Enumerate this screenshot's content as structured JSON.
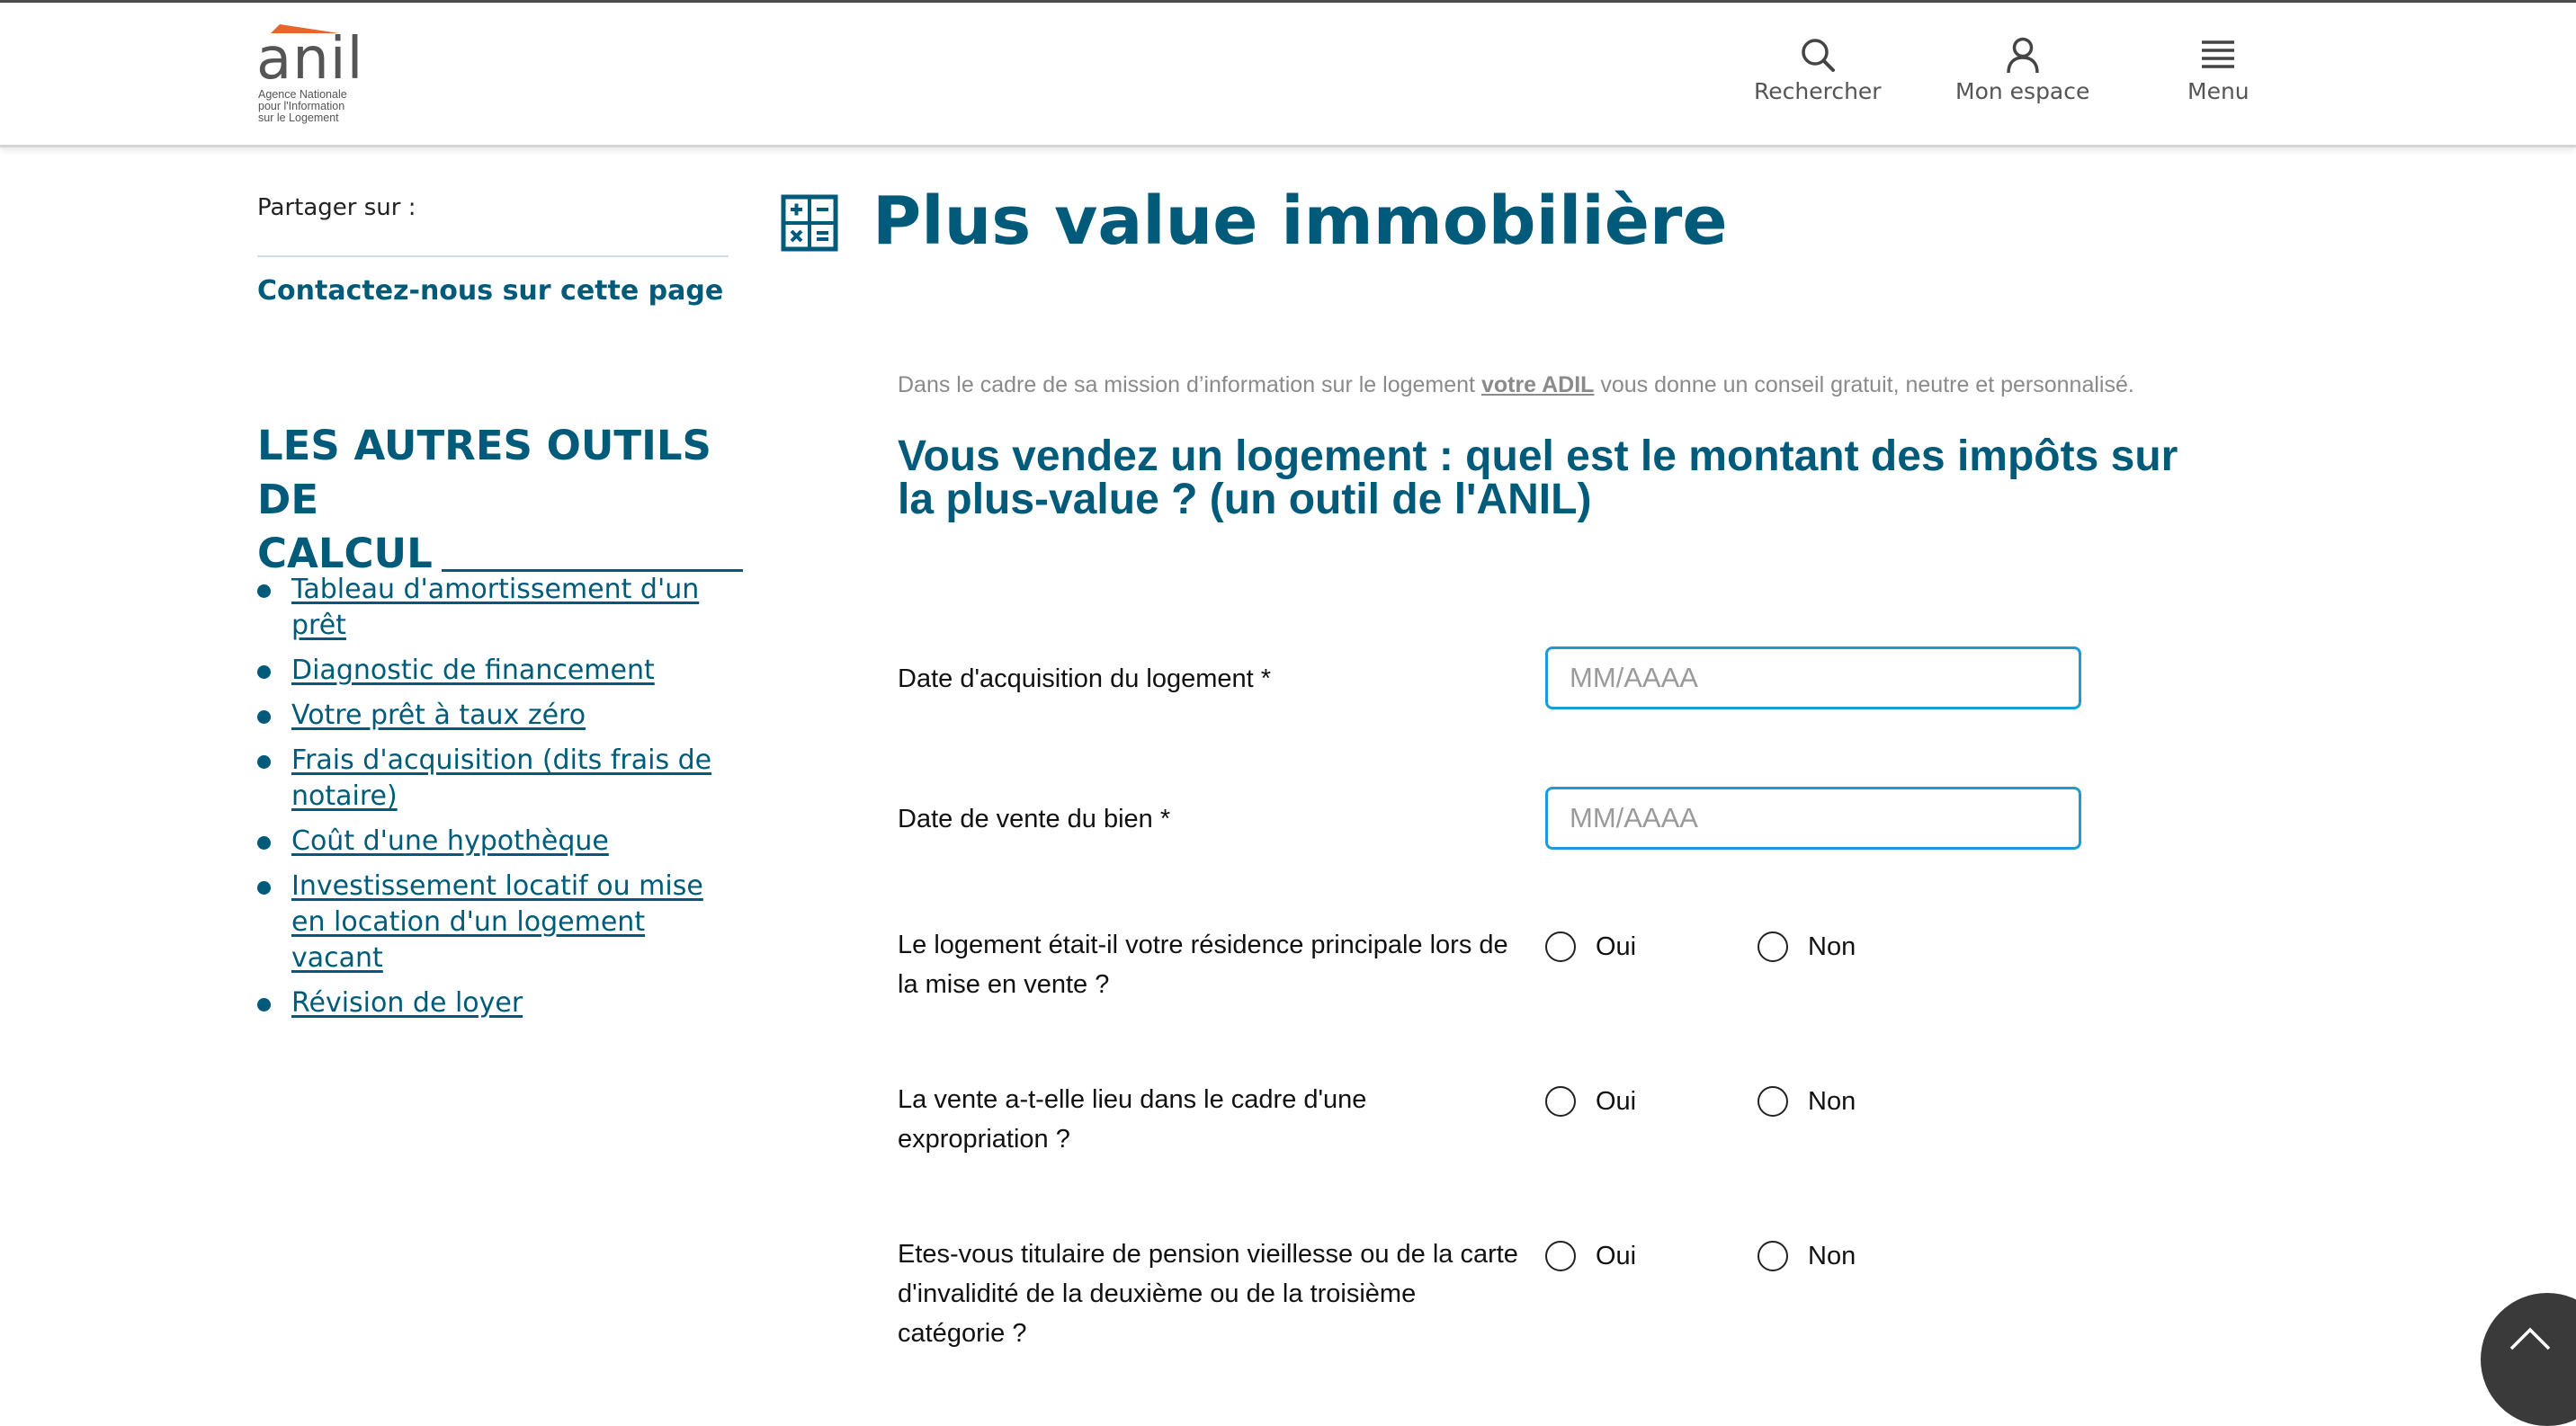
{
  "header": {
    "logo": {
      "word": "anil",
      "tagline": [
        "Agence Nationale",
        "pour l'Information",
        "sur le Logement"
      ]
    },
    "nav": [
      {
        "label": "Rechercher",
        "icon": "search-icon"
      },
      {
        "label": "Mon espace",
        "icon": "user-icon"
      },
      {
        "label": "Menu",
        "icon": "menu-icon"
      }
    ]
  },
  "sidebar": {
    "share_label": "Partager sur :",
    "contact_link": "Contactez-nous sur cette page",
    "title_line1": "LES AUTRES OUTILS DE",
    "title_line2": "CALCUL",
    "tools": [
      "Tableau d'amortissement d'un prêt",
      "Diagnostic de financement",
      "Votre prêt à taux zéro",
      "Frais d'acquisition (dits frais de notaire)",
      "Coût d'une hypothèque",
      "Investissement locatif ou mise en location d'un logement vacant",
      "Révision de loyer"
    ]
  },
  "main": {
    "page_title": "Plus value immobilière",
    "intro_before": "Dans le cadre de sa mission d’information sur le logement ",
    "intro_link": "votre ADIL",
    "intro_after": " vous donne un conseil gratuit, neutre et personnalisé.",
    "question_title": "Vous vendez un logement : quel est le montant des impôts sur la plus-value ? (un outil de l'ANIL)",
    "fields": [
      {
        "label": "Date d'acquisition du logement *",
        "placeholder": "MM/AAAA",
        "value": ""
      },
      {
        "label": "Date de vente du bien *",
        "placeholder": "MM/AAAA",
        "value": ""
      }
    ],
    "radio_questions": [
      {
        "label": "Le logement était-il votre résidence principale lors de la mise en vente ?",
        "options": [
          "Oui",
          "Non"
        ],
        "selected": null
      },
      {
        "label": "La vente a-t-elle lieu dans le cadre d'une expropriation ?",
        "options": [
          "Oui",
          "Non"
        ],
        "selected": null
      },
      {
        "label": "Etes-vous titulaire de pension vieillesse ou de la carte d'invalidité de la deuxième ou de la troisième catégorie ?",
        "options": [
          "Oui",
          "Non"
        ],
        "selected": null
      }
    ]
  },
  "scroll_top": {
    "icon": "chevron-up-icon"
  },
  "colors": {
    "brand": "#005a7a",
    "logo_accent": "#e8642c",
    "input_border": "#1e9ad6",
    "muted_text": "#8a8a8a",
    "scroll_button": "#3a3a3a"
  }
}
